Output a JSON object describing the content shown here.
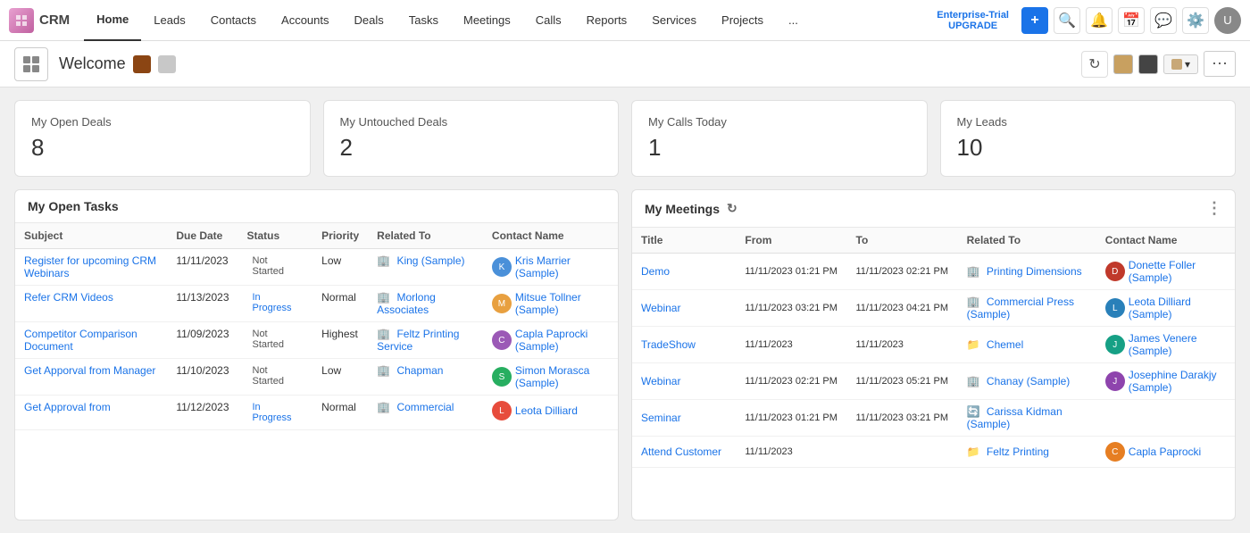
{
  "nav": {
    "logo": "CRM",
    "items": [
      "Home",
      "Leads",
      "Contacts",
      "Accounts",
      "Deals",
      "Tasks",
      "Meetings",
      "Calls",
      "Reports",
      "Services",
      "Projects",
      "..."
    ],
    "active": "Home",
    "enterprise_label": "Enterprise-Trial",
    "upgrade_label": "UPGRADE"
  },
  "subheader": {
    "welcome": "Welcome",
    "refresh_title": "Refresh"
  },
  "stat_cards": [
    {
      "label": "My Open Deals",
      "value": "8"
    },
    {
      "label": "My Untouched Deals",
      "value": "2"
    },
    {
      "label": "My Calls Today",
      "value": "1"
    },
    {
      "label": "My Leads",
      "value": "10"
    }
  ],
  "tasks_panel": {
    "title": "My Open Tasks",
    "columns": [
      "Subject",
      "Due Date",
      "Status",
      "Priority",
      "Related To",
      "Contact Name"
    ],
    "rows": [
      {
        "subject": "Register for upcoming CRM Webinars",
        "due_date": "11/11/2023",
        "status": "Not Started",
        "priority": "Low",
        "related_to": "King (Sample)",
        "contact_name": "Kris Marrier (Sample)",
        "contact_color": "#4a90d9"
      },
      {
        "subject": "Refer CRM Videos",
        "due_date": "11/13/2023",
        "status": "In Progress",
        "priority": "Normal",
        "related_to": "Morlong Associates",
        "contact_name": "Mitsue Tollner (Sample)",
        "contact_color": "#e8a040"
      },
      {
        "subject": "Competitor Comparison Document",
        "due_date": "11/09/2023",
        "status": "Not Started",
        "priority": "Highest",
        "related_to": "Feltz Printing Service",
        "contact_name": "Capla Paprocki (Sample)",
        "contact_color": "#9b59b6"
      },
      {
        "subject": "Get Apporval from Manager",
        "due_date": "11/10/2023",
        "status": "Not Started",
        "priority": "Low",
        "related_to": "Chapman",
        "contact_name": "Simon Morasca (Sample)",
        "contact_color": "#27ae60"
      },
      {
        "subject": "Get Approval from",
        "due_date": "11/12/2023",
        "status": "In Progress",
        "priority": "Normal",
        "related_to": "Commercial",
        "contact_name": "Leota Dilliard",
        "contact_color": "#e74c3c"
      }
    ]
  },
  "meetings_panel": {
    "title": "My Meetings",
    "columns": [
      "Title",
      "From",
      "To",
      "Related To",
      "Contact Name"
    ],
    "rows": [
      {
        "title": "Demo",
        "from": "11/11/2023 01:21 PM",
        "to": "11/11/2023 02:21 PM",
        "related_to": "Printing Dimensions",
        "contact_name": "Donette Foller (Sample)",
        "contact_color": "#c0392b",
        "related_icon": "🏢"
      },
      {
        "title": "Webinar",
        "from": "11/11/2023 03:21 PM",
        "to": "11/11/2023 04:21 PM",
        "related_to": "Commercial Press (Sample)",
        "contact_name": "Leota Dilliard (Sample)",
        "contact_color": "#2980b9",
        "related_icon": "🏢"
      },
      {
        "title": "TradeShow",
        "from": "11/11/2023",
        "to": "11/11/2023",
        "related_to": "Chemel",
        "contact_name": "James Venere (Sample)",
        "contact_color": "#16a085",
        "related_icon": "📁"
      },
      {
        "title": "Webinar",
        "from": "11/11/2023 02:21 PM",
        "to": "11/11/2023 05:21 PM",
        "related_to": "Chanay (Sample)",
        "contact_name": "Josephine Darakjy (Sample)",
        "contact_color": "#8e44ad",
        "related_icon": "🏢"
      },
      {
        "title": "Seminar",
        "from": "11/11/2023 01:21 PM",
        "to": "11/11/2023 03:21 PM",
        "related_to": "Carissa Kidman (Sample)",
        "contact_name": "",
        "contact_color": "#27ae60",
        "related_icon": "🔄"
      },
      {
        "title": "Attend Customer",
        "from": "11/11/2023",
        "to": "",
        "related_to": "Feltz Printing",
        "contact_name": "Capla Paprocki",
        "contact_color": "#e67e22",
        "related_icon": "📁"
      }
    ]
  },
  "colors": {
    "primary": "#1a73e8",
    "swatch1": "#8B4513",
    "swatch2": "#444444",
    "swatch3": "#c8a878",
    "accent": "#e8f0fe"
  }
}
